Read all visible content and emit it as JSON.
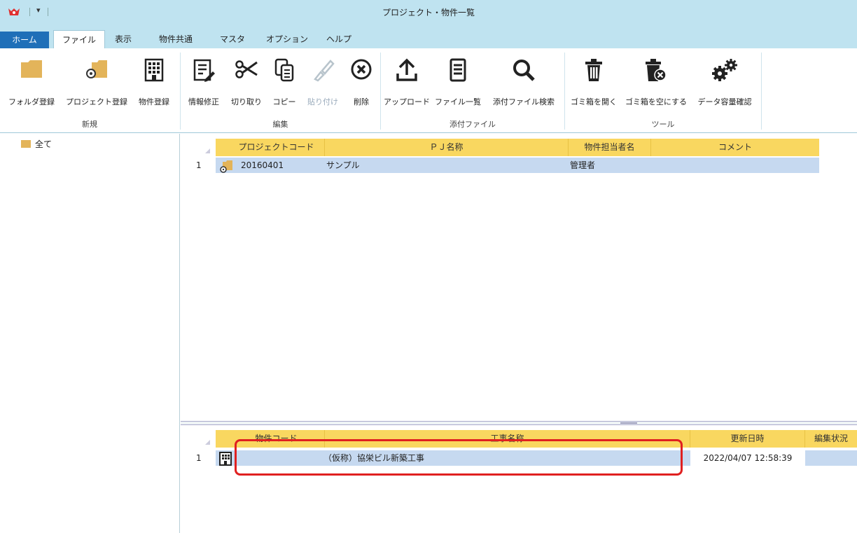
{
  "window": {
    "title": "プロジェクト・物件一覧"
  },
  "titlebar": {
    "dropdown_glyph": "▾"
  },
  "tabs": [
    {
      "label": "ホーム"
    },
    {
      "label": "ファイル"
    },
    {
      "label": "表示"
    },
    {
      "label": "物件共通"
    },
    {
      "label": "マスタ"
    },
    {
      "label": "オプション"
    },
    {
      "label": "ヘルプ"
    }
  ],
  "ribbon": {
    "groups": {
      "new": "新規",
      "edit": "編集",
      "attach": "添付ファイル",
      "tools": "ツール"
    },
    "buttons": {
      "folder_register": "フォルダ登録",
      "project_register": "プロジェクト登録",
      "property_register": "物件登録",
      "info_edit": "情報修正",
      "cut": "切り取り",
      "copy": "コピー",
      "paste": "貼り付け",
      "delete": "削除",
      "upload": "アップロード",
      "file_list": "ファイル一覧",
      "attach_search": "添付ファイル検索",
      "trash_open": "ゴミ箱を開く",
      "trash_empty": "ゴミ箱を空にする",
      "data_capacity": "データ容量確認"
    },
    "icons": {
      "folder": "folder-icon",
      "project": "project-folder-icon",
      "property": "building-icon",
      "info_edit": "edit-document-icon",
      "cut": "scissors-icon",
      "copy": "copy-icon",
      "paste": "paste-brush-icon",
      "delete": "delete-circle-icon",
      "upload": "upload-icon",
      "file_list": "file-list-icon",
      "search": "search-icon",
      "trash": "trash-icon",
      "trash_empty": "trash-x-icon",
      "gears": "gears-icon"
    }
  },
  "tree": {
    "root_label": "全て"
  },
  "project_grid": {
    "columns": [
      "プロジェクトコード",
      "ＰＪ名称",
      "物件担当者名",
      "コメント"
    ],
    "rows": [
      {
        "num": "1",
        "code": "20160401",
        "name": "サンプル",
        "manager": "管理者",
        "comment": ""
      }
    ]
  },
  "property_grid": {
    "columns": [
      "物件コード",
      "工事名称",
      "更新日時",
      "編集状況"
    ],
    "rows": [
      {
        "num": "1",
        "code": "",
        "name": "（仮称）協栄ビル新築工事",
        "updated": "2022/04/07 12:58:39",
        "status": ""
      }
    ]
  },
  "colors": {
    "ribbon_bg": "#bfe3f0",
    "home_tab": "#1f6fb8",
    "header_yellow": "#f9d760",
    "row_selected": "#c6d9f0",
    "highlight": "#e02020"
  }
}
